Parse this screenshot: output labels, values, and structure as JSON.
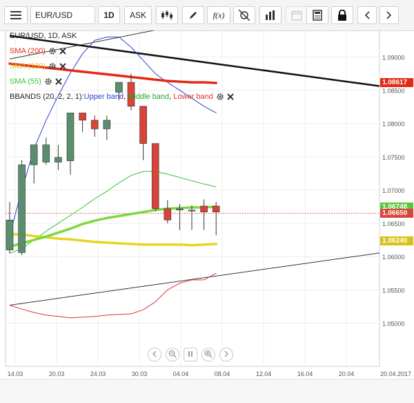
{
  "toolbar": {
    "menu_icon": "hamburger-menu-icon",
    "symbol": "EUR/USD",
    "timeframe": "1D",
    "price_type": "ASK",
    "buttons": [
      "candlestick-chart-icon",
      "pencil-draw-icon",
      "function-icon",
      "crosshair-icon",
      "bar-chart-icon",
      "calendar-icon",
      "calculator-icon",
      "lock-icon",
      "chevron-left-icon",
      "chevron-right-icon"
    ],
    "function_label": "f(x)"
  },
  "legend": {
    "instrument": "EUR/USD, 1D, ASK",
    "sma200": "SMA (200)",
    "sma100": "SMA (100)",
    "sma55": "SMA (55)",
    "bbands_prefix": "BBANDS (20, 2, 2, 1): ",
    "bb_upper": "Upper band",
    "bb_middle": "Middle band",
    "bb_lower": "Lower band",
    "sep": ", "
  },
  "colors": {
    "up_candle": "#5b8e6e",
    "down_candle": "#d8443a",
    "sma200": "#e02a14",
    "sma100": "#e6d420",
    "sma55": "#7cd83c",
    "bb_upper": "#2b3fd8",
    "bb_middle": "#33c233",
    "bb_lower": "#e23030",
    "trendline": "#111111"
  },
  "chart_data": {
    "type": "candlestick",
    "title": "EUR/USD, 1D, ASK",
    "ylim": [
      1.0435,
      1.094
    ],
    "y_ticks": [
      "1.09000",
      "1.08500",
      "1.08000",
      "1.07500",
      "1.07000",
      "1.06500",
      "1.06000",
      "1.05500",
      "1.05000"
    ],
    "x_ticks": [
      "14.03",
      "20.03",
      "24.03",
      "30.03",
      "04.04",
      "08.04",
      "12.04",
      "16.04",
      "20.04",
      "20.04.2017"
    ],
    "candles": [
      {
        "o": 1.061,
        "h": 1.0682,
        "l": 1.0605,
        "c": 1.0655
      },
      {
        "o": 1.0606,
        "h": 1.0745,
        "l": 1.0602,
        "c": 1.0738
      },
      {
        "o": 1.0738,
        "h": 1.0768,
        "l": 1.071,
        "c": 1.0768
      },
      {
        "o": 1.0742,
        "h": 1.0779,
        "l": 1.0738,
        "c": 1.0768
      },
      {
        "o": 1.0742,
        "h": 1.0768,
        "l": 1.073,
        "c": 1.0749
      },
      {
        "o": 1.0744,
        "h": 1.0816,
        "l": 1.0723,
        "c": 1.0816
      },
      {
        "o": 1.0816,
        "h": 1.0816,
        "l": 1.0787,
        "c": 1.0805
      },
      {
        "o": 1.0805,
        "h": 1.0812,
        "l": 1.078,
        "c": 1.0792
      },
      {
        "o": 1.0792,
        "h": 1.0812,
        "l": 1.0775,
        "c": 1.0805
      },
      {
        "o": 1.0847,
        "h": 1.0862,
        "l": 1.0835,
        "c": 1.0862
      },
      {
        "o": 1.0862,
        "h": 1.0875,
        "l": 1.082,
        "c": 1.0826
      },
      {
        "o": 1.0826,
        "h": 1.082,
        "l": 1.0745,
        "c": 1.077
      },
      {
        "o": 1.077,
        "h": 1.077,
        "l": 1.0668,
        "c": 1.0672
      },
      {
        "o": 1.0672,
        "h": 1.0685,
        "l": 1.065,
        "c": 1.0655
      },
      {
        "o": 1.067,
        "h": 1.0679,
        "l": 1.064,
        "c": 1.0672
      },
      {
        "o": 1.067,
        "h": 1.0677,
        "l": 1.064,
        "c": 1.067
      },
      {
        "o": 1.0676,
        "h": 1.0686,
        "l": 1.064,
        "c": 1.0667
      },
      {
        "o": 1.0676,
        "h": 1.0682,
        "l": 1.0632,
        "c": 1.0667
      }
    ],
    "sma200": [
      1.089,
      1.0888,
      1.0886,
      1.0884,
      1.0882,
      1.088,
      1.0878,
      1.0876,
      1.0874,
      1.0872,
      1.087,
      1.0868,
      1.0866,
      1.0864,
      1.0863,
      1.0862,
      1.0862,
      1.0861
    ],
    "sma100": [
      1.0634,
      1.0633,
      1.0631,
      1.0629,
      1.0627,
      1.0626,
      1.0624,
      1.0622,
      1.0621,
      1.062,
      1.0619,
      1.0618,
      1.0618,
      1.0618,
      1.0618,
      1.0617,
      1.0618,
      1.0619
    ],
    "sma55": [
      1.0615,
      1.062,
      1.0625,
      1.063,
      1.0636,
      1.0642,
      1.0649,
      1.0654,
      1.0658,
      1.0661,
      1.0664,
      1.0667,
      1.067,
      1.0672,
      1.0673,
      1.0674,
      1.0674,
      1.0675
    ],
    "bb_upper": [
      1.0632,
      1.07,
      1.0762,
      1.0805,
      1.0842,
      1.0876,
      1.0905,
      1.0925,
      1.093,
      1.093,
      1.0915,
      1.0895,
      1.0875,
      1.0862,
      1.085,
      1.0838,
      1.0826,
      1.0816
    ],
    "bb_middle": [
      1.0605,
      1.0612,
      1.0625,
      1.0638,
      1.065,
      1.0662,
      1.0674,
      1.0687,
      1.0698,
      1.0711,
      1.0722,
      1.0728,
      1.0728,
      1.0724,
      1.0719,
      1.0714,
      1.0709,
      1.0705
    ],
    "bb_lower": [
      1.0527,
      1.0521,
      1.0516,
      1.0512,
      1.051,
      1.0508,
      1.0509,
      1.051,
      1.0512,
      1.0513,
      1.0514,
      1.052,
      1.0532,
      1.055,
      1.056,
      1.0565,
      1.0565,
      1.0575
    ],
    "trendlines": [
      {
        "from": [
          0,
          1.0932
        ],
        "to": [
          33,
          1.085
        ],
        "color": "#111111",
        "width": 2.5
      },
      {
        "from": [
          0,
          1.0897
        ],
        "to": [
          27,
          1.0995
        ],
        "color": "#333333",
        "width": 1
      },
      {
        "from": [
          0,
          1.0527
        ],
        "to": [
          33,
          1.0612
        ],
        "color": "#333333",
        "width": 1
      }
    ],
    "reference_line": 1.0665,
    "price_labels": [
      {
        "value": "1.08617",
        "y": 1.0862,
        "color": "#e02a14"
      },
      {
        "value": "1.06748",
        "y": 1.0675,
        "color": "#5ac63a"
      },
      {
        "value": "1.06650",
        "y": 1.0665,
        "color": "#d8443a"
      },
      {
        "value": "1.06240",
        "y": 1.0624,
        "color": "#d8c21a"
      }
    ],
    "grid": true
  },
  "navigation": [
    "chevron-left-icon",
    "zoom-out-icon",
    "pause-icon",
    "zoom-in-icon",
    "chevron-right-icon"
  ]
}
